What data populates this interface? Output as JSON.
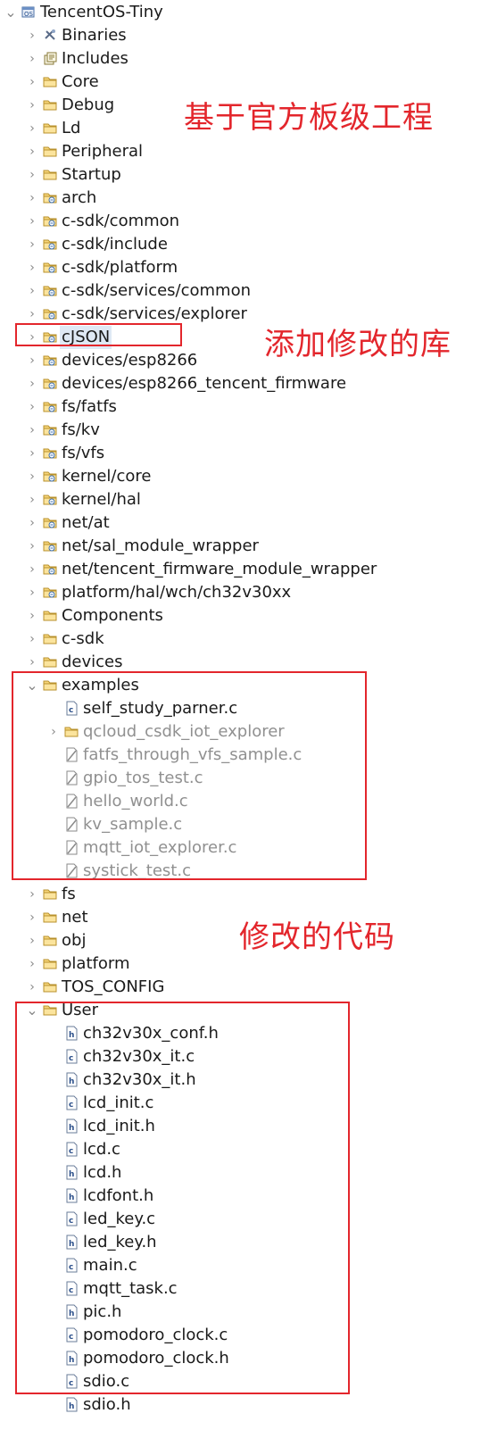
{
  "project": "TencentOS-Tiny",
  "annotations": {
    "board_project": "基于官方板级工程",
    "modified_lib": "添加修改的库",
    "modified_code": "修改的代码"
  },
  "colors": {
    "annotation": "#e3262c",
    "muted_text": "#909090"
  },
  "tree": {
    "binaries": "Binaries",
    "includes": "Includes",
    "folders": [
      "Core",
      "Debug",
      "Ld",
      "Peripheral",
      "Startup"
    ],
    "links": [
      "arch",
      "c-sdk/common",
      "c-sdk/include",
      "c-sdk/platform",
      "c-sdk/services/common",
      "c-sdk/services/explorer",
      "cJSON",
      "devices/esp8266",
      "devices/esp8266_tencent_firmware",
      "fs/fatfs",
      "fs/kv",
      "fs/vfs",
      "kernel/core",
      "kernel/hal",
      "net/at",
      "net/sal_module_wrapper",
      "net/tencent_firmware_module_wrapper",
      "platform/hal/wch/ch32v30xx"
    ],
    "folders2": [
      "Components",
      "c-sdk",
      "devices"
    ],
    "examples": {
      "label": "examples",
      "active_file": "self_study_parner.c",
      "subfolder": "qcloud_csdk_iot_explorer",
      "excluded_files": [
        "fatfs_through_vfs_sample.c",
        "gpio_tos_test.c",
        "hello_world.c",
        "kv_sample.c",
        "mqtt_iot_explorer.c",
        "systick_test.c"
      ]
    },
    "folders3": [
      "fs",
      "net",
      "obj",
      "platform",
      "TOS_CONFIG"
    ],
    "user": {
      "label": "User",
      "files": [
        "ch32v30x_conf.h",
        "ch32v30x_it.c",
        "ch32v30x_it.h",
        "lcd_init.c",
        "lcd_init.h",
        "lcd.c",
        "lcd.h",
        "lcdfont.h",
        "led_key.c",
        "led_key.h",
        "main.c",
        "mqtt_task.c",
        "pic.h",
        "pomodoro_clock.c",
        "pomodoro_clock.h",
        "sdio.c",
        "sdio.h"
      ]
    }
  }
}
